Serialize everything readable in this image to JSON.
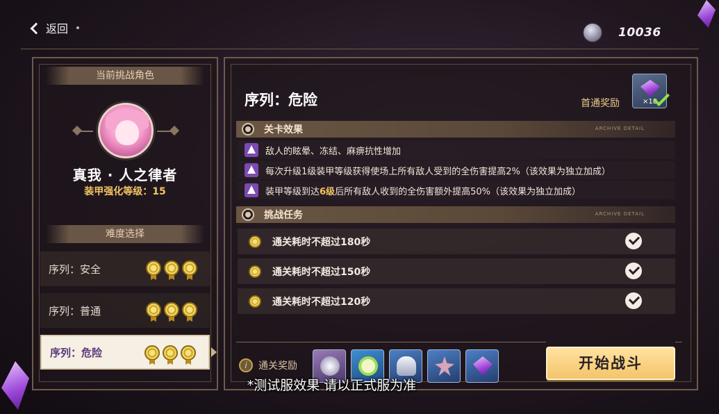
{
  "topbar": {
    "back_label": "返回",
    "currency_amount": "10036",
    "currency_icon": "dimensional-coin-icon"
  },
  "left": {
    "current_header": "当前挑战角色",
    "character_name": "真我 · 人之律者",
    "armor_level": "装甲强化等级：15",
    "difficulty_header": "难度选择",
    "difficulties": [
      {
        "label": "序列：安全",
        "medals": 3,
        "selected": false
      },
      {
        "label": "序列：普通",
        "medals": 3,
        "selected": false
      },
      {
        "label": "序列：危险",
        "medals": 3,
        "selected": true
      }
    ]
  },
  "right": {
    "title": "序列：危险",
    "first_clear_label": "首通奖励",
    "first_clear_count": "×18",
    "effects_header": "关卡效果",
    "missions_header": "挑战任务",
    "archive_tag": "ARCHIVE DETAIL",
    "effects": [
      "敌人的眩晕、冻结、麻痹抗性增加",
      "每次升级1级装甲等级获得使场上所有敌人受到的全伤害提高2%（该效果为独立加成）"
    ],
    "effect3_prefix": "装甲等级到达",
    "effect3_highlight": "6级",
    "effect3_suffix": "后所有敌人收到的全伤害额外提高50%（该效果为独立加成）",
    "missions": [
      {
        "label": "通关耗时不超过180秒",
        "completed": true
      },
      {
        "label": "通关耗时不超过150秒",
        "completed": true
      },
      {
        "label": "通关耗时不超过120秒",
        "completed": true
      }
    ],
    "clear_reward_label": "通关奖励",
    "rewards": [
      "coin-icon",
      "ring-icon",
      "helmet-icon",
      "flower-icon",
      "crystal-icon"
    ],
    "start_button": "开始战斗"
  },
  "subtitle": "*测试服效果 请以正式服为准",
  "colors": {
    "accent_gold": "#f3c462",
    "button": "#f4c46a",
    "warn_purple": "#7c4ab0"
  }
}
